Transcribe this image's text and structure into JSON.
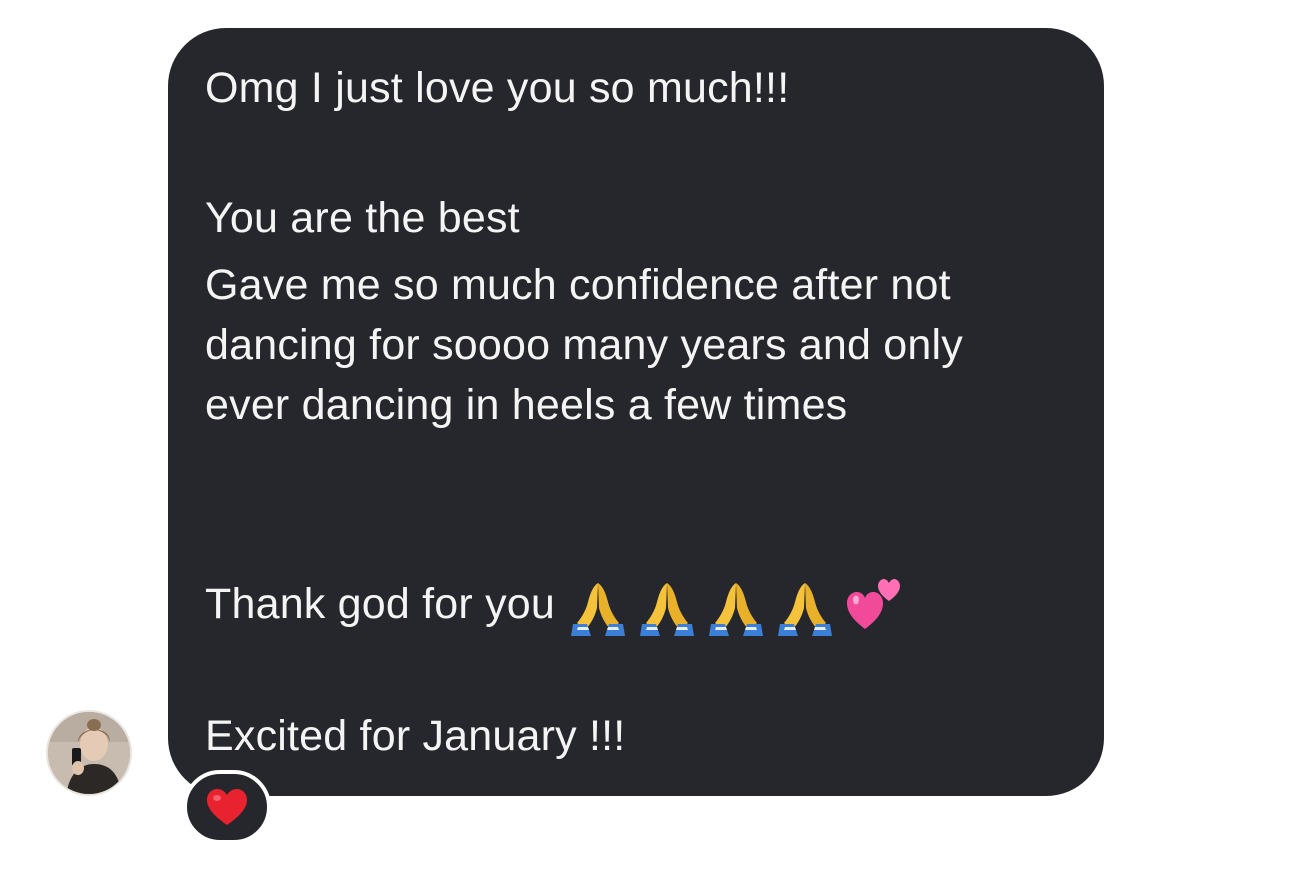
{
  "message": {
    "lines": [
      "Omg I just love you so much!!!",
      "You are the best",
      "Gave me so much confidence after not",
      "dancing for soooo many years and only",
      "ever dancing in heels a few times",
      "Thank god for you",
      "Excited for January !!!"
    ],
    "emojis": [
      "pray-emoji",
      "pray-emoji",
      "pray-emoji",
      "pray-emoji",
      "two-hearts-emoji"
    ]
  },
  "reaction": {
    "icon": "red-heart-icon"
  },
  "avatar": {
    "icon": "user-avatar"
  },
  "colors": {
    "bubble": "#26272c",
    "text": "#f4f4f4",
    "heart": "#e8232f"
  }
}
